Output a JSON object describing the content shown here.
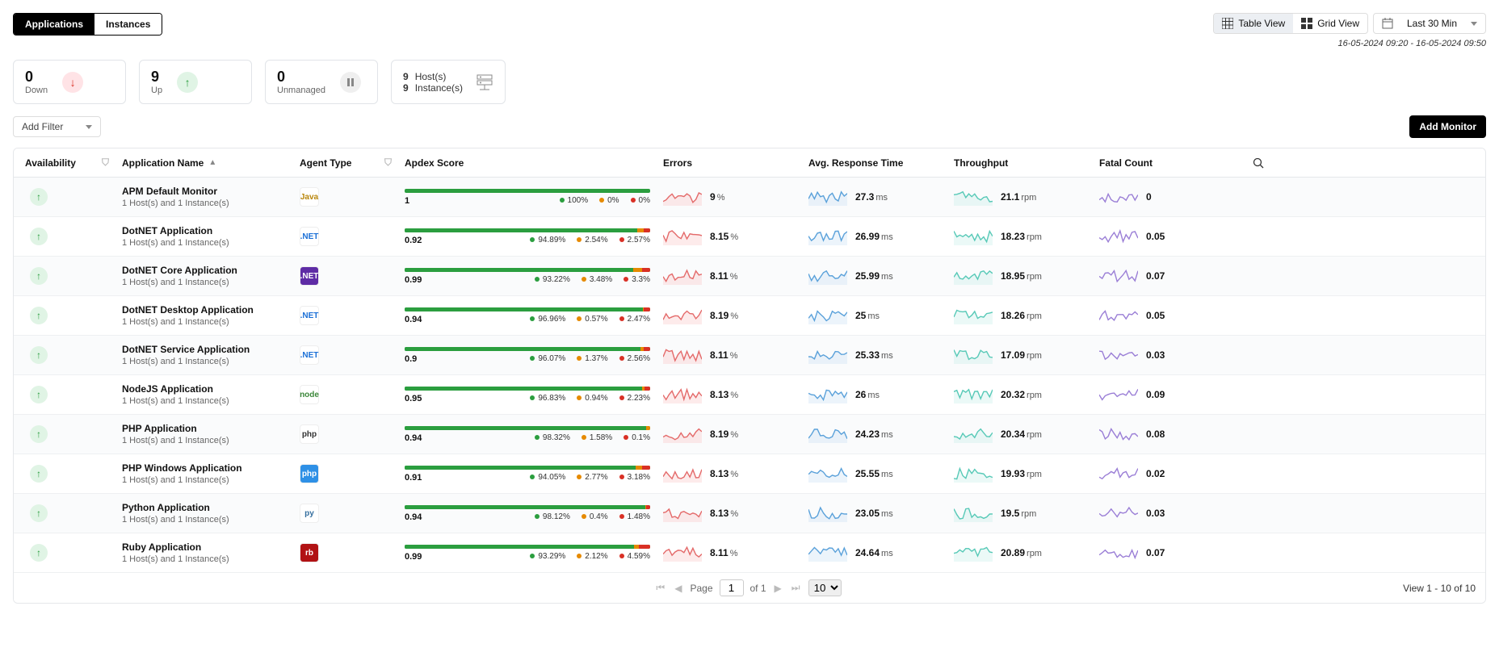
{
  "tabs": {
    "applications": "Applications",
    "instances": "Instances"
  },
  "view": {
    "table": "Table View",
    "grid": "Grid View",
    "timerange": "Last 30 Min",
    "timestamp": "16-05-2024 09:20 - 16-05-2024 09:50"
  },
  "stats": {
    "down": {
      "value": "0",
      "label": "Down"
    },
    "up": {
      "value": "9",
      "label": "Up"
    },
    "unmanaged": {
      "value": "0",
      "label": "Unmanaged"
    },
    "hosts": {
      "value": "9",
      "label": "Host(s)"
    },
    "instances": {
      "value": "9",
      "label": "Instance(s)"
    }
  },
  "controls": {
    "addFilter": "Add Filter",
    "addMonitor": "Add Monitor"
  },
  "columns": {
    "availability": "Availability",
    "appname": "Application Name",
    "agent": "Agent Type",
    "apdex": "Apdex Score",
    "errors": "Errors",
    "resp": "Avg. Response Time",
    "throughput": "Throughput",
    "fatal": "Fatal Count"
  },
  "rows": [
    {
      "name": "APM Default Monitor",
      "sub": "1 Host(s) and 1 Instance(s)",
      "agent": {
        "label": "Java",
        "bg": "#fff",
        "fg": "#b8860b"
      },
      "apdex": {
        "score": "1",
        "satisfied": "100%",
        "tolerating": "0%",
        "frustrated": "0%",
        "s": 100,
        "t": 0,
        "f": 0
      },
      "errors": "9",
      "resp": "27.3",
      "throughput": "21.1",
      "fatal": "0"
    },
    {
      "name": "DotNET Application",
      "sub": "1 Host(s) and 1 Instance(s)",
      "agent": {
        "label": ".NET",
        "bg": "#fff",
        "fg": "#1a6fd6"
      },
      "apdex": {
        "score": "0.92",
        "satisfied": "94.89%",
        "tolerating": "2.54%",
        "frustrated": "2.57%",
        "s": 94.89,
        "t": 2.54,
        "f": 2.57
      },
      "errors": "8.15",
      "resp": "26.99",
      "throughput": "18.23",
      "fatal": "0.05"
    },
    {
      "name": "DotNET Core Application",
      "sub": "1 Host(s) and 1 Instance(s)",
      "agent": {
        "label": ".NET",
        "bg": "#5e2ca5",
        "fg": "#fff"
      },
      "apdex": {
        "score": "0.99",
        "satisfied": "93.22%",
        "tolerating": "3.48%",
        "frustrated": "3.3%",
        "s": 93.22,
        "t": 3.48,
        "f": 3.3
      },
      "errors": "8.11",
      "resp": "25.99",
      "throughput": "18.95",
      "fatal": "0.07"
    },
    {
      "name": "DotNET Desktop Application",
      "sub": "1 Host(s) and 1 Instance(s)",
      "agent": {
        "label": ".NET",
        "bg": "#fff",
        "fg": "#1a6fd6"
      },
      "apdex": {
        "score": "0.94",
        "satisfied": "96.96%",
        "tolerating": "0.57%",
        "frustrated": "2.47%",
        "s": 96.96,
        "t": 0.57,
        "f": 2.47
      },
      "errors": "8.19",
      "resp": "25",
      "throughput": "18.26",
      "fatal": "0.05"
    },
    {
      "name": "DotNET Service Application",
      "sub": "1 Host(s) and 1 Instance(s)",
      "agent": {
        "label": ".NET",
        "bg": "#fff",
        "fg": "#1a6fd6"
      },
      "apdex": {
        "score": "0.9",
        "satisfied": "96.07%",
        "tolerating": "1.37%",
        "frustrated": "2.56%",
        "s": 96.07,
        "t": 1.37,
        "f": 2.56
      },
      "errors": "8.11",
      "resp": "25.33",
      "throughput": "17.09",
      "fatal": "0.03"
    },
    {
      "name": "NodeJS Application",
      "sub": "1 Host(s) and 1 Instance(s)",
      "agent": {
        "label": "node",
        "bg": "#fff",
        "fg": "#3c873a"
      },
      "apdex": {
        "score": "0.95",
        "satisfied": "96.83%",
        "tolerating": "0.94%",
        "frustrated": "2.23%",
        "s": 96.83,
        "t": 0.94,
        "f": 2.23
      },
      "errors": "8.13",
      "resp": "26",
      "throughput": "20.32",
      "fatal": "0.09"
    },
    {
      "name": "PHP Application",
      "sub": "1 Host(s) and 1 Instance(s)",
      "agent": {
        "label": "php",
        "bg": "#fff",
        "fg": "#333"
      },
      "apdex": {
        "score": "0.94",
        "satisfied": "98.32%",
        "tolerating": "1.58%",
        "frustrated": "0.1%",
        "s": 98.32,
        "t": 1.58,
        "f": 0.1
      },
      "errors": "8.19",
      "resp": "24.23",
      "throughput": "20.34",
      "fatal": "0.08"
    },
    {
      "name": "PHP Windows Application",
      "sub": "1 Host(s) and 1 Instance(s)",
      "agent": {
        "label": "php",
        "bg": "#2e90e6",
        "fg": "#fff"
      },
      "apdex": {
        "score": "0.91",
        "satisfied": "94.05%",
        "tolerating": "2.77%",
        "frustrated": "3.18%",
        "s": 94.05,
        "t": 2.77,
        "f": 3.18
      },
      "errors": "8.13",
      "resp": "25.55",
      "throughput": "19.93",
      "fatal": "0.02"
    },
    {
      "name": "Python Application",
      "sub": "1 Host(s) and 1 Instance(s)",
      "agent": {
        "label": "py",
        "bg": "#fff",
        "fg": "#356f9f"
      },
      "apdex": {
        "score": "0.94",
        "satisfied": "98.12%",
        "tolerating": "0.4%",
        "frustrated": "1.48%",
        "s": 98.12,
        "t": 0.4,
        "f": 1.48
      },
      "errors": "8.13",
      "resp": "23.05",
      "throughput": "19.5",
      "fatal": "0.03"
    },
    {
      "name": "Ruby Application",
      "sub": "1 Host(s) and 1 Instance(s)",
      "agent": {
        "label": "rb",
        "bg": "#b11214",
        "fg": "#fff"
      },
      "apdex": {
        "score": "0.99",
        "satisfied": "93.29%",
        "tolerating": "2.12%",
        "frustrated": "4.59%",
        "s": 93.29,
        "t": 2.12,
        "f": 4.59
      },
      "errors": "8.11",
      "resp": "24.64",
      "throughput": "20.89",
      "fatal": "0.07"
    }
  ],
  "units": {
    "errors": "%",
    "resp": "ms",
    "throughput": "rpm"
  },
  "pager": {
    "page_label": "Page",
    "page": "1",
    "of": "of 1",
    "perpage": "10",
    "view": "View 1 - 10 of 10"
  }
}
